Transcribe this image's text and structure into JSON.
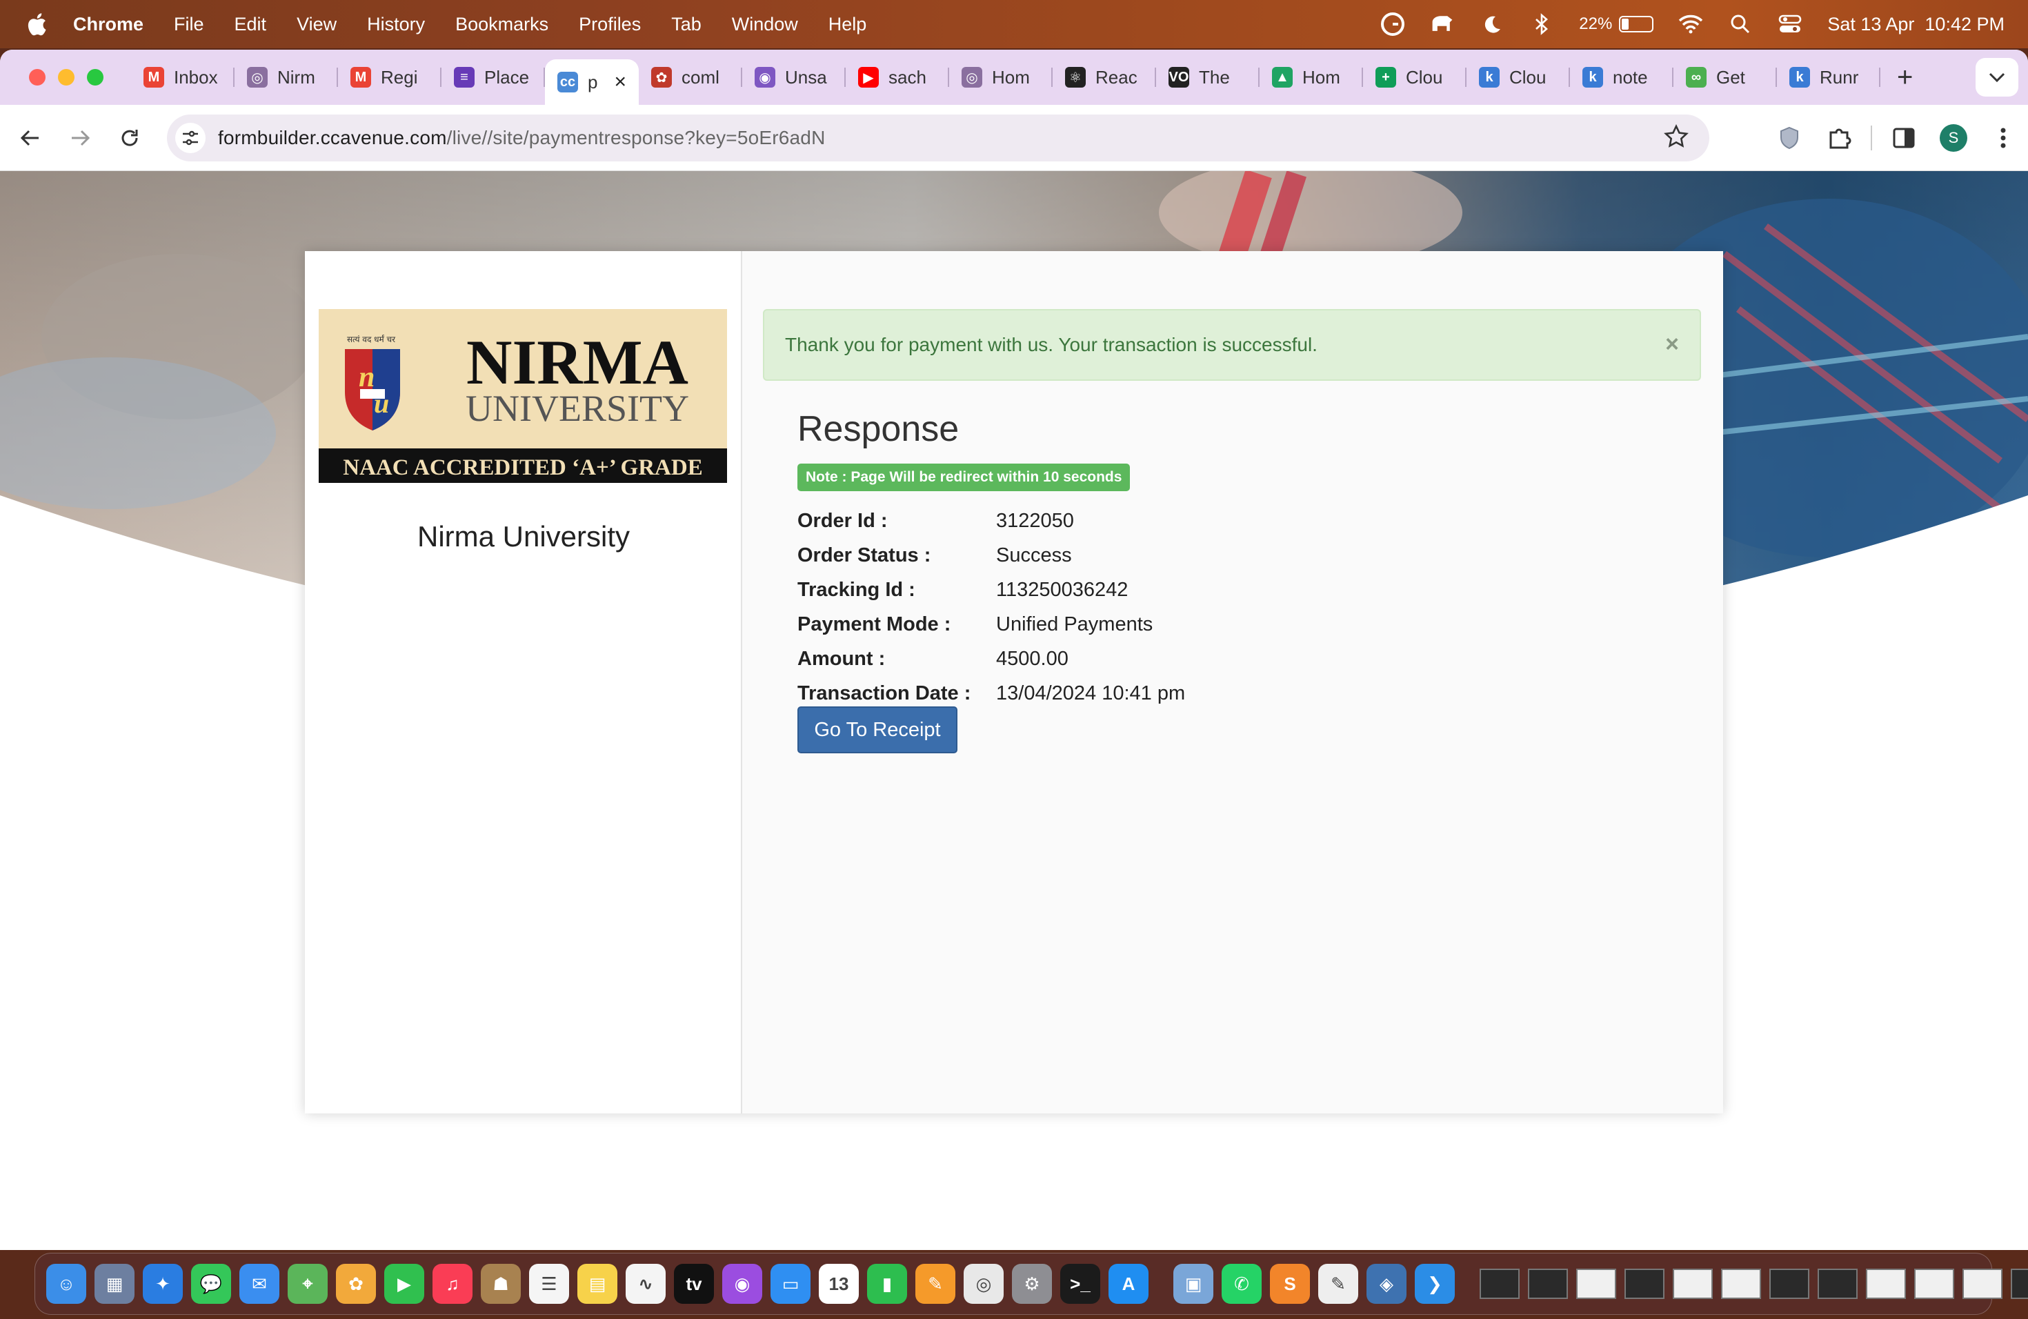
{
  "menubar": {
    "app_name": "Chrome",
    "items": [
      "File",
      "Edit",
      "View",
      "History",
      "Bookmarks",
      "Profiles",
      "Tab",
      "Window",
      "Help"
    ],
    "battery_percent": "22%",
    "battery_level": 0.22,
    "datetime": "Sat 13 Apr  10:42 PM",
    "status_icons": [
      "grammarly-icon",
      "tableplus-icon",
      "moon-icon",
      "bluetooth-icon",
      "battery-icon",
      "wifi-icon",
      "search-icon",
      "control-center-icon"
    ]
  },
  "tabs": [
    {
      "title": "Inbox",
      "icon": "gmail-icon",
      "color": "#ea4335",
      "glyph": "M"
    },
    {
      "title": "Nirm",
      "icon": "chrome-icon",
      "color": "#8a6f9f",
      "glyph": "◎"
    },
    {
      "title": "Regi",
      "icon": "gmail-icon",
      "color": "#ea4335",
      "glyph": "M"
    },
    {
      "title": "Place",
      "icon": "forms-icon",
      "color": "#673ab7",
      "glyph": "≡"
    },
    {
      "title": "p",
      "icon": "ccavenue-icon",
      "color": "#4a8ad6",
      "glyph": "cc",
      "active": true
    },
    {
      "title": "coml",
      "icon": "flower-icon",
      "color": "#c0392b",
      "glyph": "✿"
    },
    {
      "title": "Unsa",
      "icon": "circle-icon",
      "color": "#7e57c2",
      "glyph": "◉"
    },
    {
      "title": "sach",
      "icon": "youtube-icon",
      "color": "#ff0000",
      "glyph": "▶"
    },
    {
      "title": "Hom",
      "icon": "chrome-icon",
      "color": "#8a6f9f",
      "glyph": "◎"
    },
    {
      "title": "Reac",
      "icon": "react-icon",
      "color": "#222222",
      "glyph": "⚛"
    },
    {
      "title": "The",
      "icon": "vo-icon",
      "color": "#222222",
      "glyph": "VO"
    },
    {
      "title": "Hom",
      "icon": "drive-icon",
      "color": "#1fa463",
      "glyph": "▲"
    },
    {
      "title": "Clou",
      "icon": "sheets-icon",
      "color": "#0f9d58",
      "glyph": "+"
    },
    {
      "title": "Clou",
      "icon": "k-icon",
      "color": "#3a7bd5",
      "glyph": "k"
    },
    {
      "title": "note",
      "icon": "k-icon",
      "color": "#3a7bd5",
      "glyph": "k"
    },
    {
      "title": "Get",
      "icon": "link-icon",
      "color": "#4caf50",
      "glyph": "∞"
    },
    {
      "title": "Runr",
      "icon": "k-icon",
      "color": "#3a7bd5",
      "glyph": "k"
    }
  ],
  "omnibox": {
    "domain": "formbuilder.ccavenue.com",
    "path": "/live//site/paymentresponse?key=5oEr6adN"
  },
  "profile_initial": "S",
  "page": {
    "logo": {
      "motto": "सत्यं वद धर्मं चर",
      "line1": "NIRMA",
      "line2": "UNIVERSITY",
      "line3": "NAAC ACCREDITED ‘A+’ GRADE"
    },
    "university_name": "Nirma University",
    "alert_message": "Thank you for payment with us. Your transaction is successful.",
    "alert_close": "×",
    "response_title": "Response",
    "note": "Note : Page Will be redirect within 10 seconds",
    "details": [
      {
        "label": "Order Id :",
        "value": "3122050"
      },
      {
        "label": "Order Status :",
        "value": "Success"
      },
      {
        "label": "Tracking Id :",
        "value": "113250036242"
      },
      {
        "label": "Payment Mode :",
        "value": "Unified Payments"
      },
      {
        "label": "Amount :",
        "value": "4500.00"
      },
      {
        "label": "Transaction Date :",
        "value": "13/04/2024 10:41 pm"
      }
    ],
    "receipt_button": "Go To Receipt"
  },
  "dock": {
    "apps": [
      {
        "name": "finder",
        "color": "#3b8ee8",
        "glyph": "☺"
      },
      {
        "name": "launchpad",
        "color": "#6d7fa0",
        "glyph": "▦"
      },
      {
        "name": "safari",
        "color": "#2a7de1",
        "glyph": "✦"
      },
      {
        "name": "messages",
        "color": "#34c759",
        "glyph": "💬"
      },
      {
        "name": "mail",
        "color": "#3a8ef0",
        "glyph": "✉"
      },
      {
        "name": "maps",
        "color": "#5bb55a",
        "glyph": "⌖"
      },
      {
        "name": "photos",
        "color": "#f2a93b",
        "glyph": "✿"
      },
      {
        "name": "facetime",
        "color": "#30c04f",
        "glyph": "▶"
      },
      {
        "name": "music",
        "color": "#fa3d55",
        "glyph": "♫"
      },
      {
        "name": "contacts",
        "color": "#a88250",
        "glyph": "☗"
      },
      {
        "name": "reminders",
        "color": "#f5f5f5",
        "glyph": "☰"
      },
      {
        "name": "notes",
        "color": "#f7d24a",
        "glyph": "▤"
      },
      {
        "name": "freeform",
        "color": "#f4f4f4",
        "glyph": "∿"
      },
      {
        "name": "tv",
        "color": "#111111",
        "glyph": "tv"
      },
      {
        "name": "podcasts",
        "color": "#9b4de0",
        "glyph": "◉"
      },
      {
        "name": "keynote",
        "color": "#2f8ff2",
        "glyph": "▭"
      },
      {
        "name": "calendar",
        "color": "#ffffff",
        "glyph": "13"
      },
      {
        "name": "numbers",
        "color": "#2dbe4f",
        "glyph": "▮"
      },
      {
        "name": "pages",
        "color": "#f59a2a",
        "glyph": "✎"
      },
      {
        "name": "chrome",
        "color": "#e8e8e8",
        "glyph": "◎"
      },
      {
        "name": "system-settings",
        "color": "#8e8e93",
        "glyph": "⚙"
      },
      {
        "name": "terminal",
        "color": "#1b1b1b",
        "glyph": ">_"
      },
      {
        "name": "app-store",
        "color": "#1f8ef1",
        "glyph": "A"
      },
      {
        "name": "preview",
        "color": "#7aa6d8",
        "glyph": "▣"
      },
      {
        "name": "whatsapp",
        "color": "#25d366",
        "glyph": "✆"
      },
      {
        "name": "sublime-text",
        "color": "#f2852a",
        "glyph": "S"
      },
      {
        "name": "textedit",
        "color": "#eeeeee",
        "glyph": "✎"
      },
      {
        "name": "mysql-workbench",
        "color": "#3e72b0",
        "glyph": "◈"
      },
      {
        "name": "vscode",
        "color": "#2b8de6",
        "glyph": "❯"
      }
    ],
    "thumbnails": [
      "dark",
      "dark",
      "light",
      "dark",
      "light",
      "light",
      "dark",
      "dark",
      "light",
      "light",
      "light",
      "dark"
    ]
  }
}
